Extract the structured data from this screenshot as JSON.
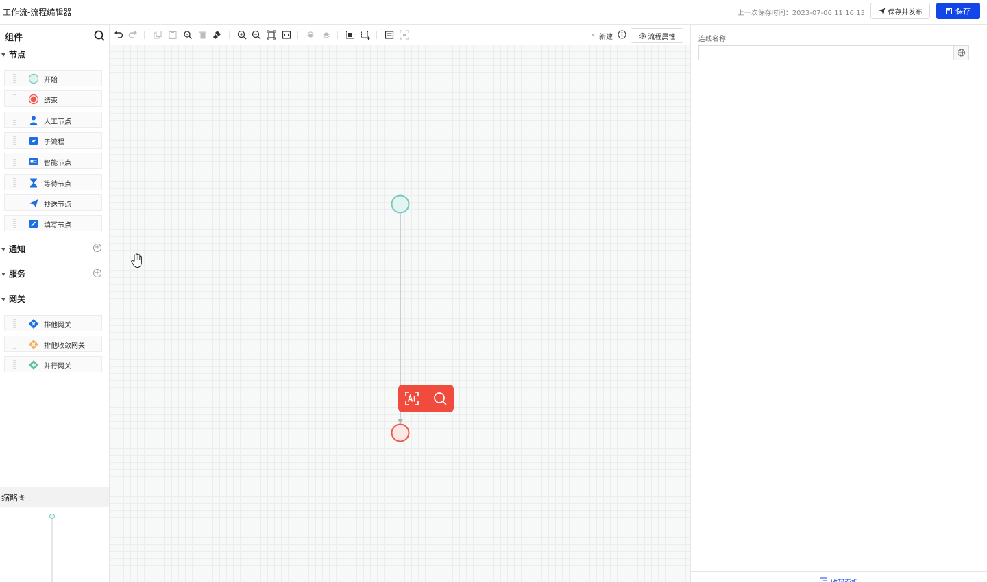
{
  "header": {
    "title": "工作流-流程编辑器",
    "save_time": "上一次保存时间：2023-07-06 11:16:13",
    "publish_label": "保存并发布",
    "save_label": "保存",
    "accent": "#1346e8"
  },
  "left_panel": {
    "title": "组件",
    "sections": {
      "nodes": "节点",
      "notify": "通知",
      "service": "服务",
      "gateway": "网关"
    },
    "node_items": [
      {
        "label": "开始",
        "icon": "start-circle-icon"
      },
      {
        "label": "结束",
        "icon": "end-circle-icon"
      },
      {
        "label": "人工节点",
        "icon": "user-icon"
      },
      {
        "label": "子流程",
        "icon": "subprocess-icon"
      },
      {
        "label": "智能节点",
        "icon": "smart-node-icon"
      },
      {
        "label": "等待节点",
        "icon": "hourglass-icon"
      },
      {
        "label": "抄送节点",
        "icon": "paper-plane-icon"
      },
      {
        "label": "填写节点",
        "icon": "form-edit-icon"
      }
    ],
    "gateway_items": [
      {
        "label": "排他网关",
        "icon": "exclusive-gateway-icon"
      },
      {
        "label": "排他收敛网关",
        "icon": "exclusive-merge-gateway-icon"
      },
      {
        "label": "并行网关",
        "icon": "parallel-gateway-icon"
      }
    ],
    "minimap_title": "缩略图"
  },
  "canvas": {
    "status": "新建",
    "props_button": "流程属性"
  },
  "right_panel": {
    "line_name_label": "连线名称",
    "line_name_value": "",
    "collapse_label": "收起面板"
  },
  "colors": {
    "start_node": "#76c9bd",
    "end_node": "#f0574b",
    "ai_toolbar": "#f14b3e",
    "edge": "#aab2bd"
  }
}
